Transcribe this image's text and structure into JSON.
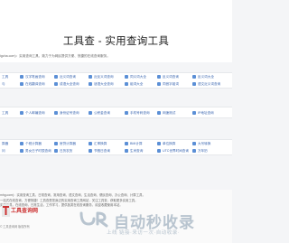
{
  "header": {
    "title": "工具查 - 实用查询工具"
  },
  "intro": "igcha.com)：实用查询工具，致力于为网民提供方便、快捷的在线查询服务。",
  "sections": [
    {
      "title": "",
      "rows": [
        [
          "工具",
          "汉字笔画查询",
          "近义词查询",
          "近反义词查询",
          "同义词大全",
          "反义词查询",
          "反义词大全"
        ],
        [
          "与",
          "在线翻译查询",
          "成语大全查询",
          "谜语大全查询",
          "组词大全",
          "同音字组词",
          "语文近义词查询"
        ]
      ]
    },
    {
      "title": "",
      "rows": [
        [
          "工具",
          "个人邮编查询",
          "身份证号查询",
          "公积金查询",
          "手机号码查询",
          "网速测试",
          "IP地址查询"
        ]
      ]
    },
    {
      "title": "",
      "rows": [
        [
          "算器",
          "个税计算器",
          "房贷计算器",
          "汇率换算",
          "BMI计算",
          "单位换算",
          "大写转换"
        ],
        [
          "问",
          "男女日子时辰查询",
          "日历农历",
          "节假日查询",
          "生肖查询",
          "UTC世界时间查询",
          "万年历"
        ]
      ]
    }
  ],
  "footer": {
    "lines": [
      "mhg.com)：实用查询工具，日常查询、常用查询、语文查询、生活查询、便民查询、办公查询、计算工具，",
      "一站式在线查询，方便快捷！工具查是您身边的实用查询工具网站，关注工具查，获取更多实用工具。",
      "实用工具，在线查询，日常生活，工作学习，提供各类在线查询服务，欢迎收藏使用本站。"
    ],
    "logo_text": "工具查询网",
    "watermark_main": "自动秒收录",
    "watermark_sub": "上线 链接·来访一次·自动收录·",
    "bottom": "© 工具查询网 版权所有"
  },
  "colors": {
    "link": "#3a66b0",
    "bullet": "#5b8fd6",
    "accent_logo": "#cc3333",
    "watermark": "#b8c4cf"
  }
}
